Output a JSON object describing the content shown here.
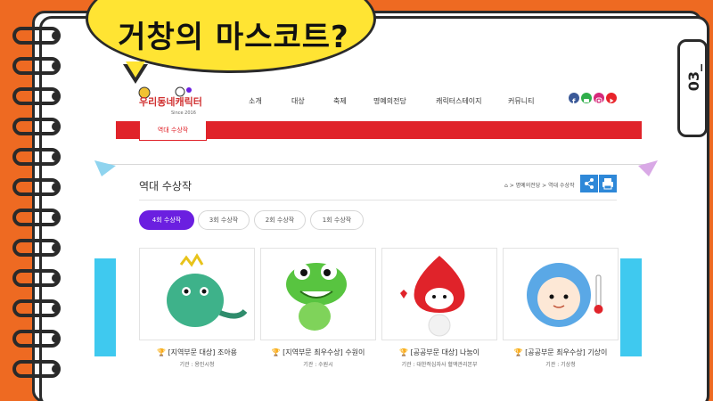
{
  "bubble": {
    "text": "거창의 마스코트?"
  },
  "side_tab": {
    "label": "03_"
  },
  "site": {
    "logo_text": "우리동네캐릭터",
    "logo_sub": "Since 2016",
    "nav": [
      "소개",
      "대상",
      "축제",
      "명예의전당",
      "캐릭터스테이지",
      "커뮤니티"
    ],
    "social": [
      {
        "name": "facebook-icon",
        "color": "#3b5998",
        "glyph": "f"
      },
      {
        "name": "chat-icon",
        "color": "#2fae4a",
        "glyph": "▬"
      },
      {
        "name": "instagram-icon",
        "color": "#d6297a",
        "glyph": "◎"
      },
      {
        "name": "youtube-icon",
        "color": "#e8232a",
        "glyph": "▶"
      }
    ],
    "tab_label": "역대 수상작"
  },
  "content": {
    "title": "역대 수상작",
    "breadcrumb": "⌂ > 명예의전당 > 역대 수상작",
    "tabs": [
      "4회 수상작",
      "3회 수상작",
      "2회 수상작",
      "1회 수상작"
    ],
    "cards": [
      {
        "title": "[지역부문 대상] 조아용",
        "org": "기관 : 용인시청",
        "color": "#3eb28a"
      },
      {
        "title": "[지역부문 최우수상] 수원이",
        "org": "기관 : 수원시",
        "color": "#58c440"
      },
      {
        "title": "[공공부문 대상] 나눔이",
        "org": "기관 : 대한적십자사 혈액관리본부",
        "color": "#e0232a"
      },
      {
        "title": "[공공부문 최우수상] 기상이",
        "org": "기관 : 기상청",
        "color": "#5aa8e6"
      }
    ]
  }
}
